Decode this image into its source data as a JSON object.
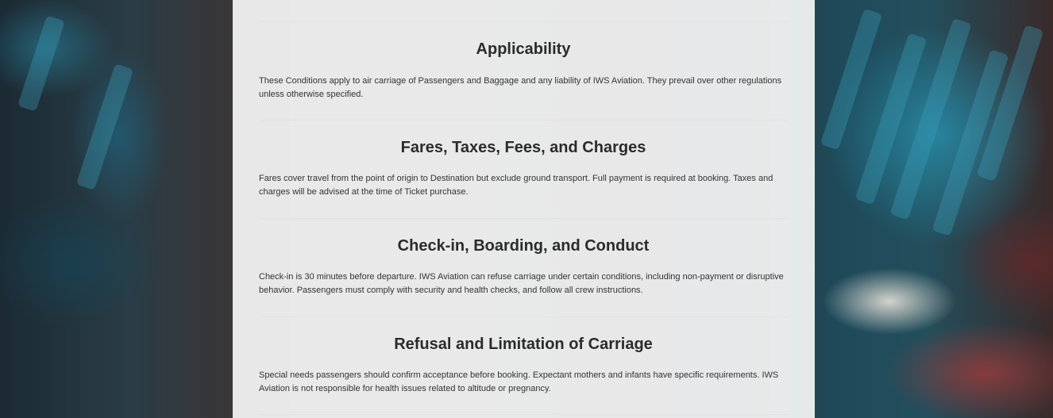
{
  "sections": [
    {
      "title": "Applicability",
      "body": "These Conditions apply to air carriage of Passengers and Baggage and any liability of IWS Aviation. They prevail over other regulations unless otherwise specified."
    },
    {
      "title": "Fares, Taxes, Fees, and Charges",
      "body": "Fares cover travel from the point of origin to Destination but exclude ground transport. Full payment is required at booking. Taxes and charges will be advised at the time of Ticket purchase."
    },
    {
      "title": "Check-in, Boarding, and Conduct",
      "body": "Check-in is 30 minutes before departure. IWS Aviation can refuse carriage under certain conditions, including non-payment or disruptive behavior. Passengers must comply with security and health checks, and follow all crew instructions."
    },
    {
      "title": "Refusal and Limitation of Carriage",
      "body": "Special needs passengers should confirm acceptance before booking. Expectant mothers and infants have specific requirements. IWS Aviation is not responsible for health issues related to altitude or pregnancy."
    }
  ]
}
